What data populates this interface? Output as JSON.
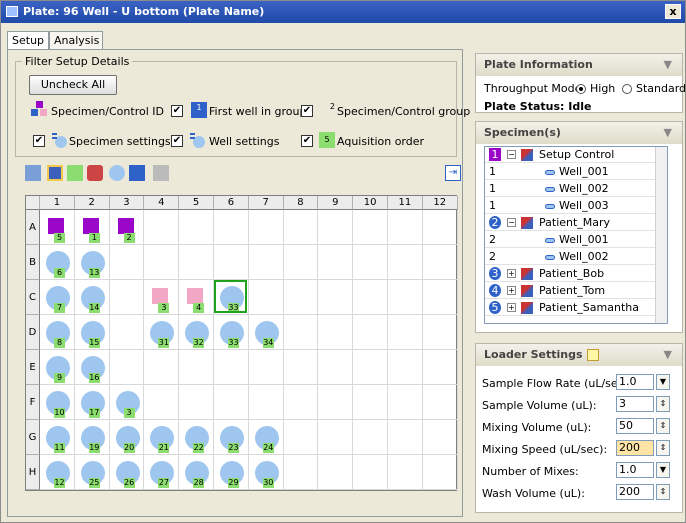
{
  "window": {
    "title": "Plate: 96 Well - U bottom  (Plate Name)",
    "close_label": "x"
  },
  "tabs": [
    {
      "label": "Setup"
    },
    {
      "label": "Analysis"
    }
  ],
  "filters": {
    "legend": "Filter Setup Details",
    "uncheck_all": "Uncheck All",
    "options": [
      {
        "label": "Specimen/Control ID",
        "checked": false
      },
      {
        "label": "First well in group",
        "checked": true
      },
      {
        "label": "Specimen/Control group",
        "checked": true
      },
      {
        "label": "Specimen settings",
        "checked": true
      },
      {
        "label": "Well settings",
        "checked": true
      },
      {
        "label": "Aquisition order",
        "checked": true
      }
    ],
    "check_mark": "✔",
    "icon_texts": {
      "first_well": "1",
      "group": "2",
      "acq": "5"
    }
  },
  "plate": {
    "columns": [
      "1",
      "2",
      "3",
      "4",
      "5",
      "6",
      "7",
      "8",
      "9",
      "10",
      "11",
      "12"
    ],
    "rows": [
      "A",
      "B",
      "C",
      "D",
      "E",
      "F",
      "G",
      "H"
    ]
  },
  "plate_info": {
    "header": "Plate Information",
    "throughput_label": "Throughput Mode:",
    "mode_high": "High",
    "mode_standard": "Standard",
    "selected_mode": "High",
    "status": "Plate Status: Idle"
  },
  "specimens": {
    "header": "Specimen(s)",
    "rows": [
      {
        "num": "1",
        "label": "Setup Control",
        "kind": "group"
      },
      {
        "num": "1",
        "label": "Well_001",
        "kind": "well"
      },
      {
        "num": "1",
        "label": "Well_002",
        "kind": "well"
      },
      {
        "num": "1",
        "label": "Well_003",
        "kind": "well"
      },
      {
        "num": "2",
        "label": "Patient_Mary",
        "kind": "group"
      },
      {
        "num": "2",
        "label": "Well_001",
        "kind": "well"
      },
      {
        "num": "2",
        "label": "Well_002",
        "kind": "well"
      },
      {
        "num": "3",
        "label": "Patient_Bob",
        "kind": "collapsed"
      },
      {
        "num": "4",
        "label": "Patient_Tom",
        "kind": "collapsed"
      },
      {
        "num": "5",
        "label": "Patient_Samantha",
        "kind": "collapsed"
      }
    ]
  },
  "loader": {
    "header": "Loader Settings",
    "fields": [
      {
        "label": "Sample Flow Rate (uL/sec):",
        "value": "1.0",
        "control": "dropdown"
      },
      {
        "label": "Sample Volume (uL):",
        "value": "3",
        "control": "spinner"
      },
      {
        "label": "Mixing Volume (uL):",
        "value": "50",
        "control": "spinner"
      },
      {
        "label": "Mixing Speed (uL/sec):",
        "value": "200",
        "control": "spinner",
        "highlight": true
      },
      {
        "label": "Number of Mixes:",
        "value": "1.0",
        "control": "dropdown"
      },
      {
        "label": "Wash Volume (uL):",
        "value": "200",
        "control": "spinner"
      }
    ]
  },
  "colors": {
    "accent": "#2f62c8",
    "well": "#9fc6ef",
    "purple": "#9a07c9",
    "pink": "#f2a7c4",
    "badge": "#8bdd6f",
    "selected": "#21a21e"
  }
}
